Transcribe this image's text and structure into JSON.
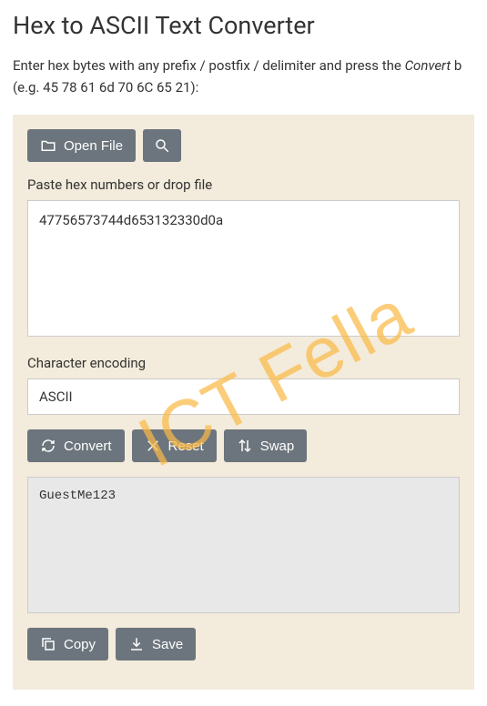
{
  "title": "Hex to ASCII Text Converter",
  "description_prefix": "Enter hex bytes with any prefix / postfix / delimiter and press the ",
  "description_button_word": "Convert",
  "description_suffix": " b",
  "description_example": "(e.g. 45 78 61 6d 70 6C 65 21):",
  "toolbar": {
    "open_file_label": "Open File",
    "search_label": ""
  },
  "input_label": "Paste hex numbers or drop file",
  "input_value": "47756573744d653132330d0a",
  "encoding_label": "Character encoding",
  "encoding_value": "ASCII",
  "actions": {
    "convert_label": "Convert",
    "reset_label": "Reset",
    "swap_label": "Swap"
  },
  "output_value": "GuestMe123",
  "output_actions": {
    "copy_label": "Copy",
    "save_label": "Save"
  },
  "watermark": "ICT Fella"
}
